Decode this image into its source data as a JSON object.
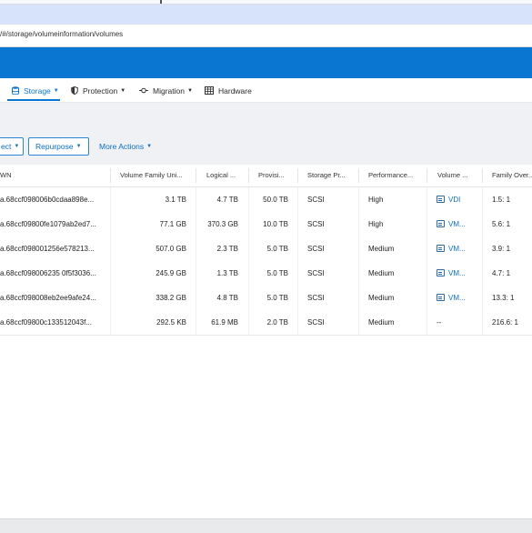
{
  "browser": {
    "url": "/#/storage/volumeinformation/volumes"
  },
  "nav": {
    "items": [
      {
        "label": "Storage",
        "icon": "database-icon",
        "has_caret": true,
        "active": true
      },
      {
        "label": "Protection",
        "icon": "shield-icon",
        "has_caret": true,
        "active": false
      },
      {
        "label": "Migration",
        "icon": "migration-icon",
        "has_caret": true,
        "active": false
      },
      {
        "label": "Hardware",
        "icon": "hardware-icon",
        "has_caret": false,
        "active": false
      }
    ]
  },
  "toolbar": {
    "protect_label": "ect",
    "repurpose_label": "Repurpose",
    "more_actions_label": "More Actions"
  },
  "table": {
    "columns": [
      "WN",
      "Volume Family Uni...",
      "Logical ...",
      "Provisi...",
      "Storage Pr...",
      "Performance...",
      "Volume ...",
      "Family Over..."
    ],
    "rows": [
      {
        "wwn": "a.68ccf098006b0cdaa898e...",
        "family_unique": "3.1 TB",
        "logical": "4.7 TB",
        "provisioned": "50.0 TB",
        "storage_protocol": "SCSI",
        "performance": "High",
        "volume_group": "VDI",
        "volume_group_linked": true,
        "family_overhead": "1.5: 1"
      },
      {
        "wwn": "a.68ccf09800fe1079ab2ed7...",
        "family_unique": "77.1 GB",
        "logical": "370.3 GB",
        "provisioned": "10.0 TB",
        "storage_protocol": "SCSI",
        "performance": "High",
        "volume_group": "VM...",
        "volume_group_linked": true,
        "family_overhead": "5.6: 1"
      },
      {
        "wwn": "a.68ccf098001256e578213...",
        "family_unique": "507.0 GB",
        "logical": "2.3 TB",
        "provisioned": "5.0 TB",
        "storage_protocol": "SCSI",
        "performance": "Medium",
        "volume_group": "VM...",
        "volume_group_linked": true,
        "family_overhead": "3.9: 1"
      },
      {
        "wwn": "a.68ccf098006235 0f5f3036...",
        "family_unique": "245.9 GB",
        "logical": "1.3 TB",
        "provisioned": "5.0 TB",
        "storage_protocol": "SCSI",
        "performance": "Medium",
        "volume_group": "VM...",
        "volume_group_linked": true,
        "family_overhead": "4.7: 1"
      },
      {
        "wwn": "a.68ccf098008eb2ee9afe24...",
        "family_unique": "338.2 GB",
        "logical": "4.8 TB",
        "provisioned": "5.0 TB",
        "storage_protocol": "SCSI",
        "performance": "Medium",
        "volume_group": "VM...",
        "volume_group_linked": true,
        "family_overhead": "13.3: 1"
      },
      {
        "wwn": "a.68ccf09800c133512043f...",
        "family_unique": "292.5 KB",
        "logical": "61.9 MB",
        "provisioned": "2.0 TB",
        "storage_protocol": "SCSI",
        "performance": "Medium",
        "volume_group": "--",
        "volume_group_linked": false,
        "family_overhead": "216.6: 1"
      }
    ]
  },
  "colors": {
    "brand_bar": "#0b76d1",
    "tab_strip": "#d6e3fb",
    "link": "#0b6fc4",
    "panel_background": "#eff1f4"
  }
}
